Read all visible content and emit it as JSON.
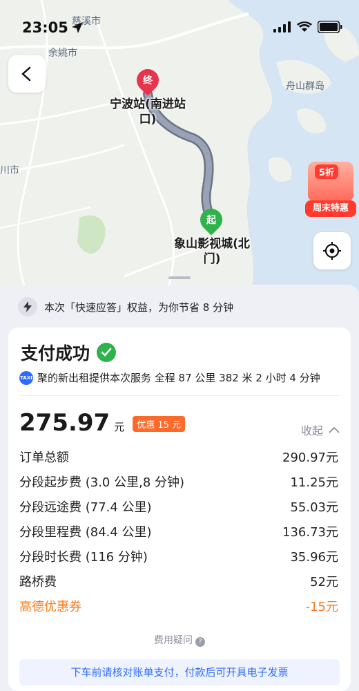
{
  "status_bar": {
    "time": "23:05"
  },
  "map": {
    "labels": {
      "cixi": "慈溪市",
      "yuyao": "余姚市",
      "zhoushan": "舟山群岛",
      "left_city": "川市"
    },
    "end_marker": "终",
    "start_marker": "起",
    "destination": "宁波站(南进站口)",
    "destination_line1": "宁波站(南进站",
    "destination_line2": "口)",
    "origin": "象山影视城(北门)",
    "origin_line1": "象山影视城(北",
    "origin_line2": "门)",
    "route_color": "#8a94a6"
  },
  "promo": {
    "badge": "5折",
    "tag": "周末特惠"
  },
  "notice": {
    "text": "本次「快速应答」权益，为你节省 8 分钟"
  },
  "payment": {
    "title": "支付成功",
    "service_badge": "TAXI",
    "service_text": "聚的新出租提供本次服务 全程 87 公里 382 米 2 小时 4 分钟",
    "amount": "275.97",
    "unit": "元",
    "discount_badge": "优惠 15 元",
    "collapse_label": "收起",
    "fees": [
      {
        "label": "订单总额",
        "value": "290.97元"
      },
      {
        "label": "分段起步费 (3.0 公里,8 分钟)",
        "value": "11.25元"
      },
      {
        "label": "分段远途费 (77.4 公里)",
        "value": "55.03元"
      },
      {
        "label": "分段里程费 (84.4 公里)",
        "value": "136.73元"
      },
      {
        "label": "分段时长费 (116 分钟)",
        "value": "35.96元"
      },
      {
        "label": "路桥费",
        "value": "52元"
      },
      {
        "label": "高德优惠券",
        "value": "-15元"
      }
    ],
    "faq": "费用疑问",
    "bottom_tip": "下车前请核对账单支付，付款后可开具电子发票"
  },
  "colors": {
    "success": "#2eb34a",
    "coupon": "#ff7a1a",
    "accent": "#2f6bff",
    "end_marker": "#e6344a"
  }
}
